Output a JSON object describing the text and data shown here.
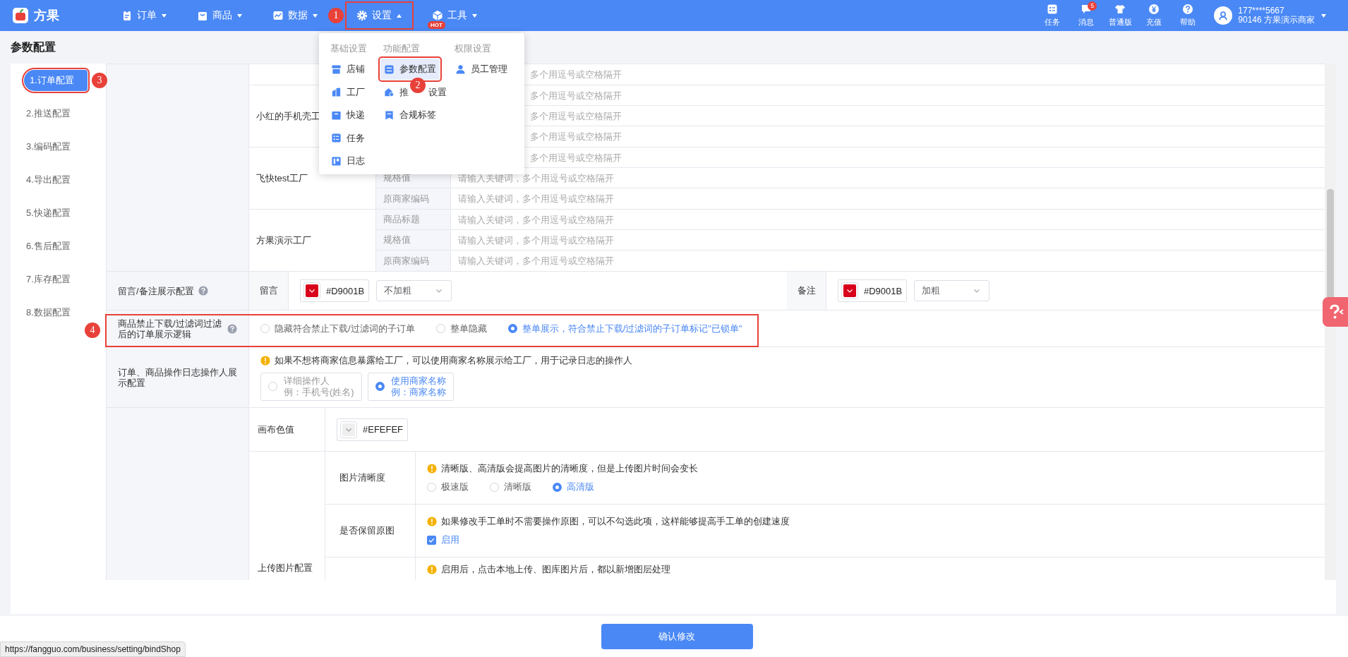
{
  "topbar": {
    "logo": "方果",
    "nav": [
      {
        "label": "订单",
        "expanded": false
      },
      {
        "label": "商品",
        "expanded": false
      },
      {
        "label": "数据",
        "expanded": false
      },
      {
        "label": "设置",
        "expanded": true,
        "annotation": "1"
      },
      {
        "label": "工具",
        "expanded": false,
        "badge": "HOT"
      }
    ],
    "actions": [
      {
        "label": "任务"
      },
      {
        "label": "消息",
        "badge": "5"
      },
      {
        "label": "普通版"
      },
      {
        "label": "充值"
      },
      {
        "label": "帮助"
      }
    ],
    "user": {
      "phone": "177****5667",
      "shop": "90146 方果演示商家"
    }
  },
  "settings_menu": {
    "columns": [
      {
        "heading": "基础设置",
        "items": [
          {
            "label": "店铺",
            "selected": false
          },
          {
            "label": "工厂",
            "selected": false
          },
          {
            "label": "快递",
            "selected": false
          },
          {
            "label": "任务",
            "selected": false
          },
          {
            "label": "日志",
            "selected": false
          }
        ]
      },
      {
        "heading": "功能配置",
        "items": [
          {
            "label": "参数配置",
            "selected": true,
            "annotation": "2"
          },
          {
            "label": "推 设置",
            "selected": false
          },
          {
            "label": "合规标签",
            "selected": false
          }
        ]
      },
      {
        "heading": "权限设置",
        "items": [
          {
            "label": "员工管理",
            "selected": false
          }
        ]
      }
    ]
  },
  "page_title": "参数配置",
  "sidebar": [
    {
      "label": "1.订单配置",
      "selected": true,
      "annotation": "3"
    },
    {
      "label": "2.推送配置",
      "selected": false
    },
    {
      "label": "3.编码配置",
      "selected": false
    },
    {
      "label": "4.导出配置",
      "selected": false
    },
    {
      "label": "5.快递配置",
      "selected": false
    },
    {
      "label": "6.售后配置",
      "selected": false
    },
    {
      "label": "7.库存配置",
      "selected": false
    },
    {
      "label": "8.数据配置",
      "selected": false
    }
  ],
  "keyword_filters": [
    {
      "rows": [
        {
          "placeholder": "多个用逗号或空格隔开"
        }
      ]
    },
    {
      "name": "小红的手机壳工",
      "rows": [
        {
          "placeholder": "多个用逗号或空格隔开"
        },
        {
          "placeholder": "多个用逗号或空格隔开"
        },
        {
          "placeholder": "多个用逗号或空格隔开"
        }
      ]
    },
    {
      "name": "飞快test工厂",
      "rows": [
        {
          "placeholder": "多个用逗号或空格隔开"
        },
        {
          "field": "规格值",
          "placeholder": "请输入关键词，多个用逗号或空格隔开"
        },
        {
          "field": "原商家编码",
          "placeholder": "请输入关键词，多个用逗号或空格隔开"
        }
      ]
    },
    {
      "name": "方果演示工厂",
      "rows": [
        {
          "field": "商品标题",
          "placeholder": "请输入关键词，多个用逗号或空格隔开"
        },
        {
          "field": "规格值",
          "placeholder": "请输入关键词，多个用逗号或空格隔开"
        },
        {
          "field": "原商家编码",
          "placeholder": "请输入关键词，多个用逗号或空格隔开"
        }
      ]
    }
  ],
  "message_display": {
    "label": "留言/备注展示配置",
    "parts": [
      {
        "label": "留言",
        "color": "#d9001b",
        "value": "#D9001B",
        "weight": "不加粗"
      },
      {
        "label": "备注",
        "color": "#d9001b",
        "value": "#D9001B",
        "weight": "加粗"
      }
    ]
  },
  "filter_logic": {
    "label": "商品禁止下载/过滤词过滤后的订单展示逻辑",
    "annotation": "4",
    "options": [
      {
        "label": "隐藏符合禁止下载/过滤词的子订单",
        "selected": false
      },
      {
        "label": "整单隐藏",
        "selected": false
      },
      {
        "label": "整单展示，符合禁止下载/过滤词的子订单标记\"已锁单\"",
        "selected": true
      }
    ]
  },
  "operator_display": {
    "label": "订单、商品操作日志操作人展示配置",
    "info": "如果不想将商家信息暴露给工厂，可以使用商家名称展示给工厂，用于记录日志的操作人",
    "options": [
      {
        "title": "详细操作人",
        "example": "例：手机号(姓名)",
        "selected": false
      },
      {
        "title": "使用商家名称",
        "example": "例：商家名称",
        "selected": true
      }
    ]
  },
  "canvas_color": {
    "label": "画布色值",
    "color": "#efefef",
    "value": "#EFEFEF"
  },
  "image_upload": {
    "label": "上传图片配置",
    "rows": [
      {
        "kind": "radio",
        "label": "图片清晰度",
        "info": "清晰版、高清版会提高图片的清晰度，但是上传图片时间会变长",
        "options": [
          {
            "label": "极速版",
            "selected": false
          },
          {
            "label": "清晰版",
            "selected": false
          },
          {
            "label": "高清版",
            "selected": true
          }
        ]
      },
      {
        "kind": "checkbox",
        "label": "是否保留原图",
        "info": "如果修改手工单时不需要操作原图，可以不勾选此项，这样能够提高手工单的创建速度",
        "option": {
          "label": "启用",
          "checked": true
        }
      },
      {
        "kind": "info",
        "info": "启用后，点击本地上传、图库图片后，都以新增图层处理"
      }
    ]
  },
  "confirm_button": "确认修改",
  "status_url": "https://fangguo.com/business/setting/bindShop"
}
